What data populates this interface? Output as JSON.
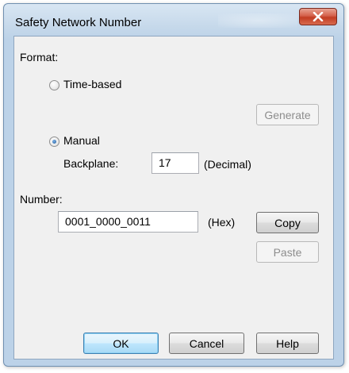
{
  "window": {
    "title": "Safety Network Number",
    "close_symbol": "x"
  },
  "format": {
    "label": "Format:",
    "time_based_label": "Time-based",
    "generate_label": "Generate",
    "manual_label": "Manual",
    "selected": "Manual",
    "backplane_label": "Backplane:",
    "backplane_value": "17",
    "backplane_unit": "(Decimal)"
  },
  "number": {
    "label": "Number:",
    "value": "0001_0000_0011",
    "unit": "(Hex)",
    "copy_label": "Copy",
    "paste_label": "Paste"
  },
  "buttons": {
    "ok": "OK",
    "cancel": "Cancel",
    "help": "Help"
  },
  "colors": {
    "title_bar": "#c5d8ea",
    "close_button": "#c23c22",
    "default_button": "#bee6fd"
  }
}
